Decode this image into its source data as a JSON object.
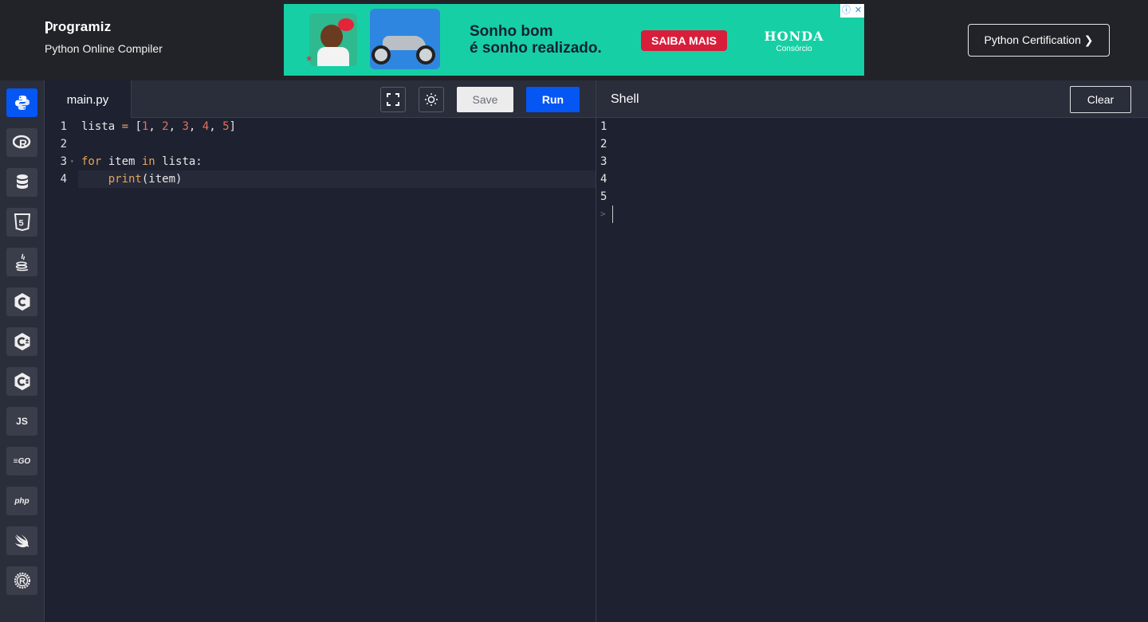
{
  "header": {
    "logo_text": "rogramiz",
    "subtitle": "Python Online Compiler",
    "cert_button": "Python Certification ❯"
  },
  "ad": {
    "headline_line1": "Sonho bom",
    "headline_line2": "é sonho realizado.",
    "cta": "SAIBA MAIS",
    "brand": "HONDA",
    "brand_sub": "Consórcio",
    "info_icon": "ⓘ",
    "close_icon": "✕"
  },
  "sidebar": {
    "items": [
      {
        "name": "python",
        "icon": "python-icon",
        "active": true
      },
      {
        "name": "r",
        "icon": "r-icon"
      },
      {
        "name": "sql",
        "icon": "database-icon"
      },
      {
        "name": "html",
        "icon": "html5-icon"
      },
      {
        "name": "java",
        "icon": "java-icon"
      },
      {
        "name": "c",
        "icon": "c-icon"
      },
      {
        "name": "cpp",
        "icon": "cpp-icon"
      },
      {
        "name": "csharp",
        "icon": "csharp-icon"
      },
      {
        "name": "js",
        "icon": "javascript-icon",
        "label": "JS"
      },
      {
        "name": "go",
        "icon": "go-icon",
        "label": "GO"
      },
      {
        "name": "php",
        "icon": "php-icon",
        "label": "php"
      },
      {
        "name": "swift",
        "icon": "swift-icon"
      },
      {
        "name": "rust",
        "icon": "rust-icon"
      }
    ]
  },
  "editor": {
    "file_tab": "main.py",
    "save_label": "Save",
    "run_label": "Run",
    "lines": [
      {
        "number": "1",
        "text": "lista = [1, 2, 3, 4, 5]"
      },
      {
        "number": "2",
        "text": ""
      },
      {
        "number": "3",
        "text": "for item in lista:"
      },
      {
        "number": "4",
        "text": "    print(item)"
      }
    ]
  },
  "shell": {
    "title": "Shell",
    "clear_label": "Clear",
    "output": [
      "1",
      "2",
      "3",
      "4",
      "5"
    ],
    "prompt": ">"
  },
  "colors": {
    "accent": "#0556f3",
    "background": "#1d2130",
    "panel": "#2a2d3a",
    "keyword": "#e6a45a",
    "number": "#e7705b"
  }
}
